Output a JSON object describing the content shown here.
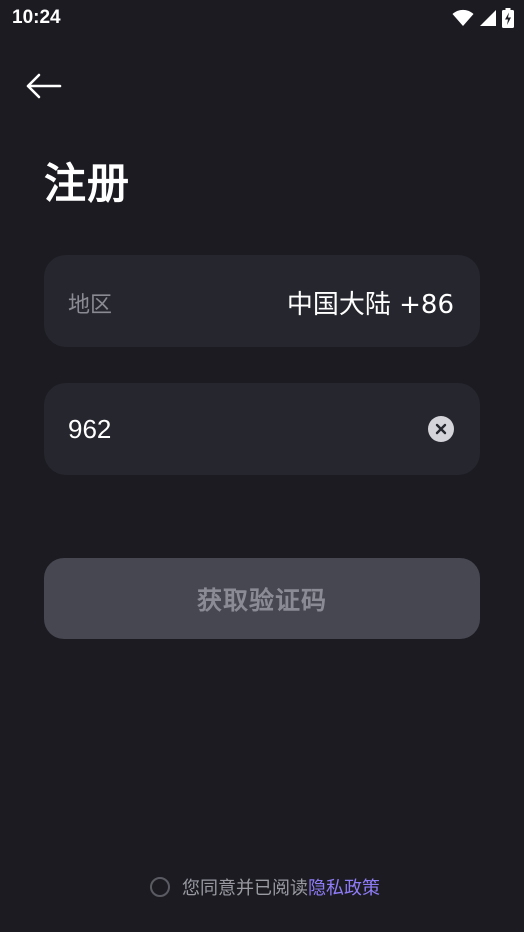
{
  "status_bar": {
    "time": "10:24"
  },
  "header": {
    "back_icon": "arrow-left-icon",
    "title": "注册"
  },
  "form": {
    "region_label": "地区",
    "region_value": "中国大陆 +86",
    "phone_value": "962",
    "clear_icon": "clear-circle-icon",
    "submit_label": "获取验证码"
  },
  "agreement": {
    "text": "您同意并已阅读",
    "link_label": "隐私政策",
    "checked": false
  },
  "colors": {
    "background": "#1b1b21",
    "field": "#26262f",
    "button_disabled": "#474751",
    "link": "#8f7cf7"
  }
}
